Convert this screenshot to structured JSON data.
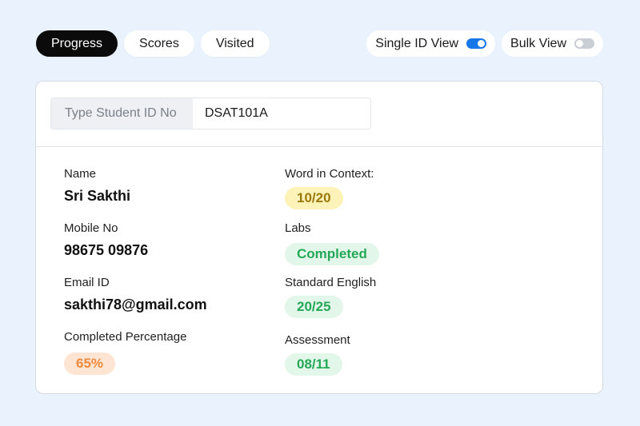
{
  "tabs": [
    {
      "label": "Progress",
      "active": true
    },
    {
      "label": "Scores",
      "active": false
    },
    {
      "label": "Visited",
      "active": false
    }
  ],
  "view_toggles": [
    {
      "label": "Single ID View",
      "on": true
    },
    {
      "label": "Bulk View",
      "on": false
    }
  ],
  "search": {
    "label": "Type Student ID No",
    "value": "DSAT101A"
  },
  "student": {
    "name_label": "Name",
    "name": "Sri Sakthi",
    "mobile_label": "Mobile No",
    "mobile": "98675 09876",
    "email_label": "Email ID",
    "email": "sakthi78@gmail.com",
    "completed_label": "Completed Percentage",
    "completed": "65%"
  },
  "scores": {
    "wic_label": "Word in Context:",
    "wic": "10/20",
    "labs_label": "Labs",
    "labs": "Completed",
    "se_label": "Standard English",
    "se": "20/25",
    "assessment_label": "Assessment",
    "assessment": "08/11"
  },
  "colors": {
    "background": "#eaf3fd",
    "active_tab": "#0b0b0b",
    "toggle_on": "#1877e8",
    "badge_orange": "#f08a3c",
    "badge_yellow": "#9a7a0b",
    "badge_green": "#24a858"
  }
}
